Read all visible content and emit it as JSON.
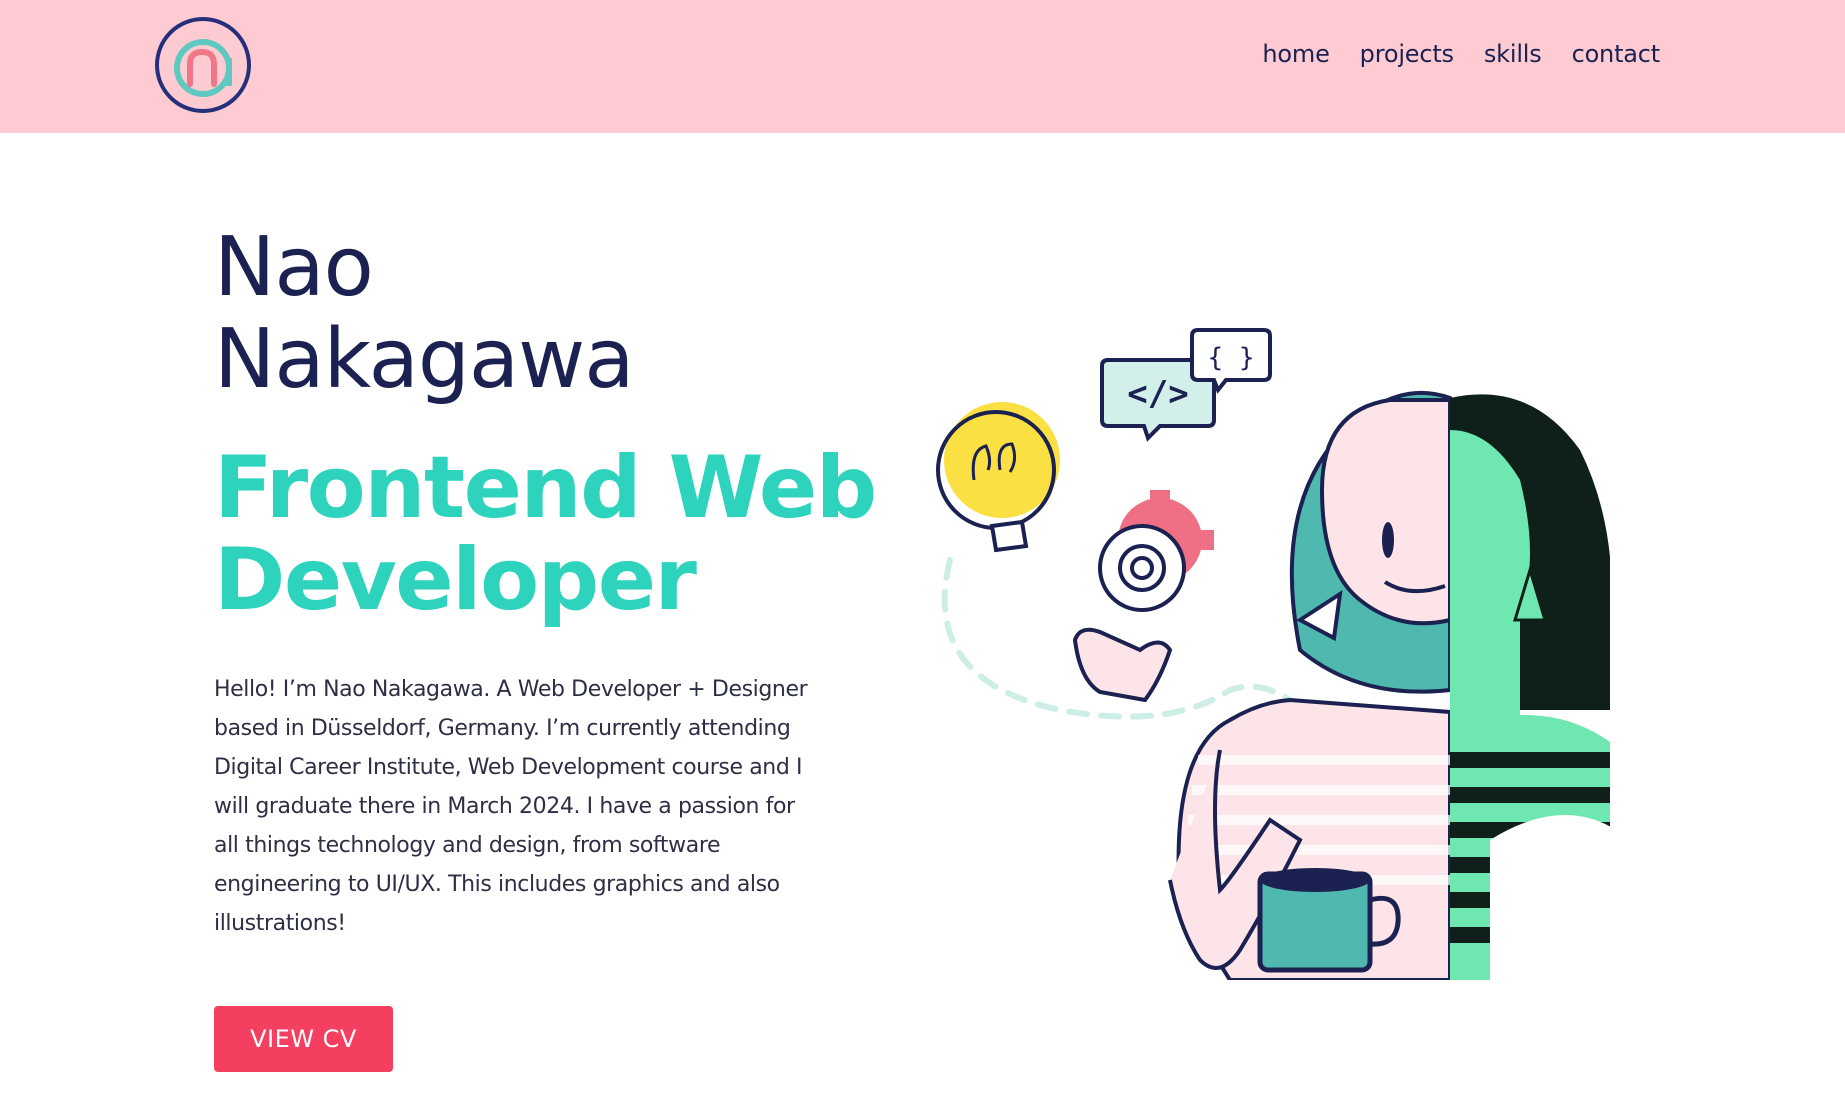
{
  "header": {
    "logo_letters": "na",
    "nav": [
      {
        "label": "home"
      },
      {
        "label": "projects"
      },
      {
        "label": "skills"
      },
      {
        "label": "contact"
      }
    ]
  },
  "hero": {
    "name_line1": "Nao",
    "name_line2": "Nakagawa",
    "role_line1": "Frontend Web",
    "role_line2": "Developer",
    "intro": "Hello! I’m Nao Nakagawa. A Web Developer + Designer based in Düsseldorf, Germany. I’m currently attending Digital Career Institute, Web Development course and I will graduate there in March 2024. I have a passion for all things technology and design, from software engineering to UI/UX. This includes graphics and also illustrations!",
    "cv_button": "VIEW CV"
  },
  "illustration": {
    "code_bubble": "</>",
    "brace_bubble": "{ }"
  },
  "colors": {
    "header_bg": "#fecbd3",
    "navy": "#1b2150",
    "teal": "#2ed3bd",
    "button": "#f43f60",
    "yellow": "#fbe043",
    "gear_pink": "#ef6f84",
    "hair_teal": "#4fb8af",
    "photo_green": "#6ee8b0"
  }
}
